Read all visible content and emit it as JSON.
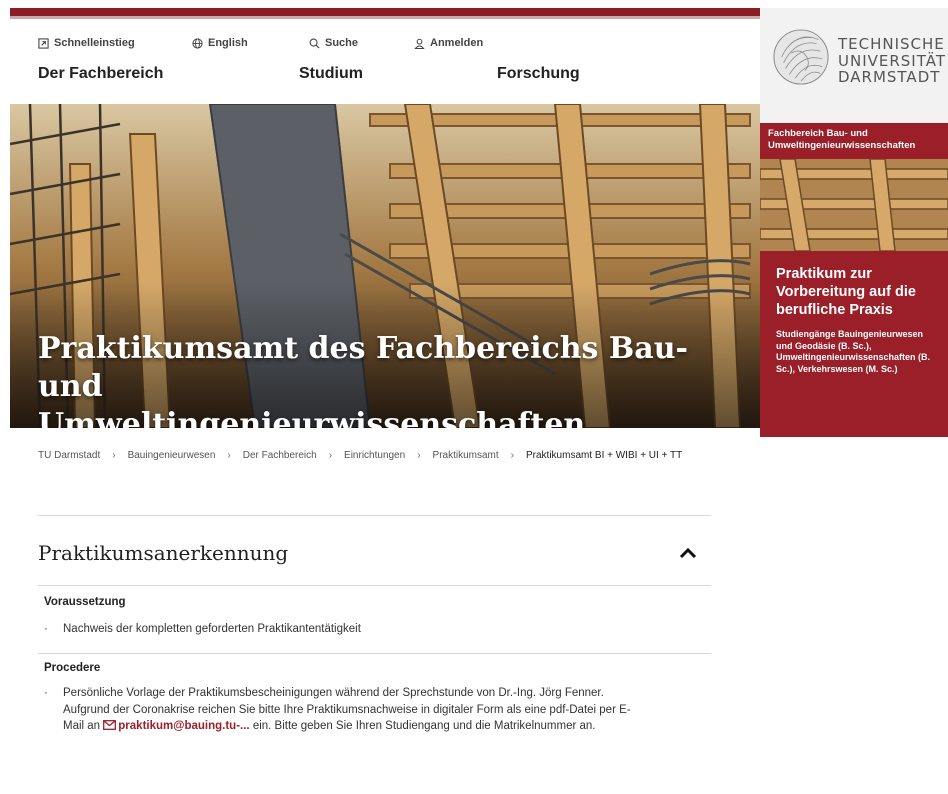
{
  "service_nav": [
    {
      "label": "Schnelleinstieg",
      "icon": "quick-access-icon"
    },
    {
      "label": "English",
      "icon": "globe-icon"
    },
    {
      "label": "Suche",
      "icon": "search-icon"
    },
    {
      "label": "Anmelden",
      "icon": "user-icon"
    }
  ],
  "main_nav": [
    "Der Fachbereich",
    "Studium",
    "Forschung"
  ],
  "logo": {
    "line1": "TECHNISCHE",
    "line2": "UNIVERSITÄT",
    "line3": "DARMSTADT"
  },
  "hero": {
    "title_line1": "Praktikumsamt des Fachbereichs Bau- und",
    "title_line2": "Umweltingenieurwissenschaften"
  },
  "department": "Fachbereich Bau- und Umweltingenieurwissenschaften",
  "info_box": {
    "title": "Praktikum zur Vorbereitung auf die berufliche Praxis",
    "subtitle": "Studiengänge Bauingenieurwesen und Geodäsie (B. Sc.), Umweltingenieurwissenschaften (B. Sc.), Verkehrswesen (M. Sc.)"
  },
  "breadcrumb": [
    "TU Darmstadt",
    "Bauingenieurwesen",
    "Der Fachbereich",
    "Einrichtungen",
    "Praktikumsamt",
    "Praktikumsamt BI + WIBI + UI + TT"
  ],
  "breadcrumb_separator": "›",
  "accordion": {
    "title": "Praktikumsanerkennung",
    "sections": [
      {
        "heading": "Voraussetzung",
        "bullet": "Nachweis der kompletten geforderten Praktikantentätigkeit"
      },
      {
        "heading": "Procedere",
        "bullet_line1": "Persönliche Vorlage der Praktikumsbescheinigungen während der Sprechstunde von Dr.-Ing. Jörg Fenner.",
        "bullet_line2": "Aufgrund der Coronakrise reichen Sie bitte Ihre Praktikumsnachweise in digitaler Form als eine pdf-Datei per E-",
        "bullet_line3_pre": "Mail an ",
        "mail_link": "praktikum@bauing.tu-...",
        "bullet_line3_post": " ein. Bitte geben Sie Ihren Studiengang und die Matrikelnummer an."
      }
    ]
  },
  "bullet_char": "·",
  "colors": {
    "brand_red": "#9b1f29",
    "topbar": "#8b1d24"
  }
}
